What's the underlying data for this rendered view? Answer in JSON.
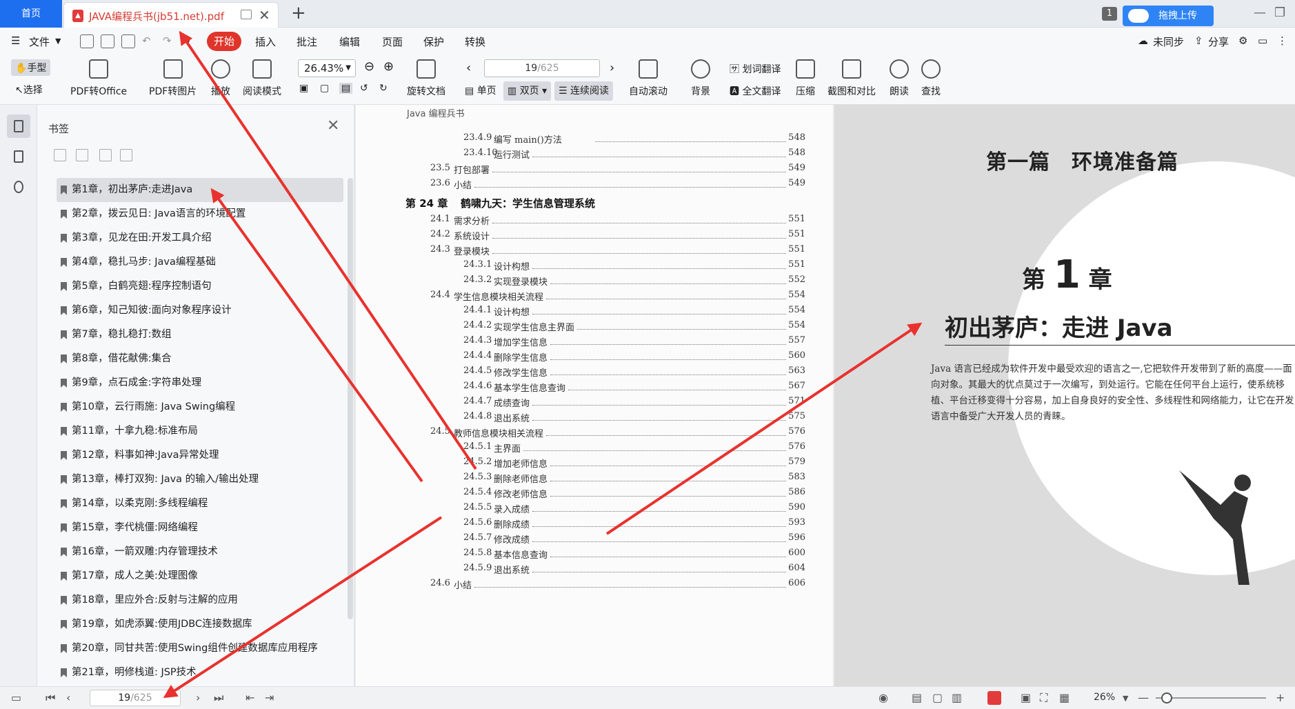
{
  "titlebar": {
    "home_tab": "首页",
    "doc_tab_title": "JAVA编程兵书(jb51.net).pdf",
    "badge": "1",
    "upload_label": "拖拽上传"
  },
  "menubar": {
    "file": "文件",
    "items": [
      "开始",
      "插入",
      "批注",
      "编辑",
      "页面",
      "保护",
      "转换"
    ],
    "right": {
      "sync": "未同步",
      "share": "分享"
    }
  },
  "ribbon": {
    "hand": "手型",
    "select": "选择",
    "pdf_to_office": "PDF转Office",
    "pdf_to_image": "PDF转图片",
    "play": "播放",
    "read_mode": "阅读模式",
    "zoom": "26.43%",
    "page_current": "19",
    "page_total": "/625",
    "rotate": "旋转文档",
    "single": "单页",
    "double": "双页",
    "continuous": "连续阅读",
    "auto_scroll": "自动滚动",
    "background": "背景",
    "word_translate": "划词翻译",
    "full_translate": "全文翻译",
    "compress": "压缩",
    "screenshot_compare": "截图和对比",
    "read_aloud": "朗读",
    "find": "查找"
  },
  "bookmarks": {
    "title": "书签",
    "items": [
      "第1章，初出茅庐:走进Java",
      "第2章，拨云见日: Java语言的环境配置",
      "第3章，见龙在田:开发工具介绍",
      "第4章，稳扎马步: Java编程基础",
      "第5章，白鹤亮翅:程序控制语句",
      "第6章，知己知彼:面向对象程序设计",
      "第7章，稳扎稳打:数组",
      "第8章，借花献佛:集合",
      "第9章，点石成金:字符串处理",
      "第10章，云行雨施: Java Swing编程",
      "第11章，十拿九稳:标准布局",
      "第12章，料事如神:Java异常处理",
      "第13章，棒打双狗: Java 的输入/输出处理",
      "第14章，以柔克刚:多线程编程",
      "第15章，李代桃僵:网络编程",
      "第16章，一箭双雕:内存管理技术",
      "第17章，成人之美:处理图像",
      "第18章，里应外合:反射与注解的应用",
      "第19章，如虎添翼:使用JDBC连接数据库",
      "第20章，同甘共苦:使用Swing组件创建数据库应用程序",
      "第21章，明修栈道: JSP技术"
    ]
  },
  "doc_left": {
    "running_head": "Java 编程兵书",
    "toc": [
      {
        "level": 3,
        "num": "23.4.9",
        "title": "编写 main()方法",
        "page": "548"
      },
      {
        "level": 3,
        "num": "23.4.10",
        "title": "运行测试",
        "page": "548"
      },
      {
        "level": 2,
        "num": "23.5",
        "title": "打包部署",
        "page": "549"
      },
      {
        "level": 2,
        "num": "23.6",
        "title": "小结",
        "page": "549"
      },
      {
        "level": 1,
        "num": "第 24 章",
        "title": "鹤啸九天：学生信息管理系统",
        "page": ""
      },
      {
        "level": 2,
        "num": "24.1",
        "title": "需求分析",
        "page": "551"
      },
      {
        "level": 2,
        "num": "24.2",
        "title": "系统设计",
        "page": "551"
      },
      {
        "level": 2,
        "num": "24.3",
        "title": "登录模块",
        "page": "551"
      },
      {
        "level": 3,
        "num": "24.3.1",
        "title": "设计构想",
        "page": "551"
      },
      {
        "level": 3,
        "num": "24.3.2",
        "title": "实现登录模块",
        "page": "552"
      },
      {
        "level": 2,
        "num": "24.4",
        "title": "学生信息模块相关流程",
        "page": "554"
      },
      {
        "level": 3,
        "num": "24.4.1",
        "title": "设计构想",
        "page": "554"
      },
      {
        "level": 3,
        "num": "24.4.2",
        "title": "实现学生信息主界面",
        "page": "554"
      },
      {
        "level": 3,
        "num": "24.4.3",
        "title": "增加学生信息",
        "page": "557"
      },
      {
        "level": 3,
        "num": "24.4.4",
        "title": "删除学生信息",
        "page": "560"
      },
      {
        "level": 3,
        "num": "24.4.5",
        "title": "修改学生信息",
        "page": "563"
      },
      {
        "level": 3,
        "num": "24.4.6",
        "title": "基本学生信息查询",
        "page": "567"
      },
      {
        "level": 3,
        "num": "24.4.7",
        "title": "成绩查询",
        "page": "571"
      },
      {
        "level": 3,
        "num": "24.4.8",
        "title": "退出系统",
        "page": "575"
      },
      {
        "level": 2,
        "num": "24.5",
        "title": "教师信息模块相关流程",
        "page": "576"
      },
      {
        "level": 3,
        "num": "24.5.1",
        "title": "主界面",
        "page": "576"
      },
      {
        "level": 3,
        "num": "24.5.2",
        "title": "增加老师信息",
        "page": "579"
      },
      {
        "level": 3,
        "num": "24.5.3",
        "title": "删除老师信息",
        "page": "583"
      },
      {
        "level": 3,
        "num": "24.5.4",
        "title": "修改老师信息",
        "page": "586"
      },
      {
        "level": 3,
        "num": "24.5.5",
        "title": "录入成绩",
        "page": "590"
      },
      {
        "level": 3,
        "num": "24.5.6",
        "title": "删除成绩",
        "page": "593"
      },
      {
        "level": 3,
        "num": "24.5.7",
        "title": "修改成绩",
        "page": "596"
      },
      {
        "level": 3,
        "num": "24.5.8",
        "title": "基本信息查询",
        "page": "600"
      },
      {
        "level": 3,
        "num": "24.5.9",
        "title": "退出系统",
        "page": "604"
      },
      {
        "level": 2,
        "num": "24.6",
        "title": "小结",
        "page": "606"
      }
    ]
  },
  "doc_right": {
    "part_title": "第一篇　环境准备篇",
    "chapter_prefix": "第",
    "chapter_number": "1",
    "chapter_suffix": "章",
    "chapter_title": "初出茅庐：走进 Java",
    "intro": "Java 语言已经成为软件开发中最受欢迎的语言之一,它把软件开发带到了新的高度——面向对象。其最大的优点莫过于一次编写，到处运行。它能在任何平台上运行，使系统移植、平台迁移变得十分容易，加上自身良好的安全性、多线程性和网络能力，让它在开发语言中备受广大开发人员的青睐。"
  },
  "statusbar": {
    "page_current": "19",
    "page_total": "/625",
    "zoom": "26%"
  },
  "colors": {
    "accent_blue": "#1e6ff0",
    "start_red": "#e0352b",
    "arrow_red": "#e8322e"
  }
}
